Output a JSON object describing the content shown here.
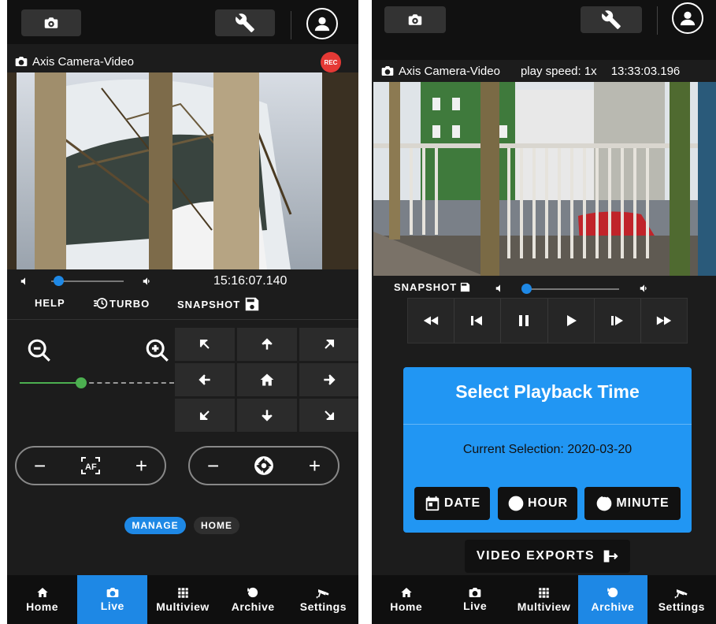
{
  "left": {
    "camera_name": "Axis Camera-Video",
    "rec_badge": "REC",
    "timestamp": "15:16:07.140",
    "volume_fraction": 0.1,
    "actions": {
      "help": "HELP",
      "turbo": "TURBO",
      "snapshot": "SNAPSHOT"
    },
    "zoom_fraction": 0.4,
    "tabs": {
      "manage": "MANAGE",
      "home": "HOME"
    },
    "pill_minus": "−",
    "pill_plus": "+"
  },
  "right": {
    "camera_name": "Axis Camera-Video",
    "play_speed": "play speed: 1x",
    "timestamp": "13:33:03.196",
    "snapshot": "SNAPSHOT",
    "volume_fraction": 0.0,
    "playback": {
      "title": "Select Playback Time",
      "current_selection": "Current Selection: 2020-03-20",
      "date_label": "DATE",
      "hour_label": "HOUR",
      "minute_label": "MINUTE"
    },
    "video_exports": "VIDEO EXPORTS"
  },
  "nav": {
    "home": "Home",
    "live": "Live",
    "multiview": "Multiview",
    "archive": "Archive",
    "settings": "Settings"
  },
  "colors": {
    "accent": "#1e88e5",
    "rec": "#e53935",
    "card": "#2196f3",
    "zoom_green": "#4caf50"
  }
}
